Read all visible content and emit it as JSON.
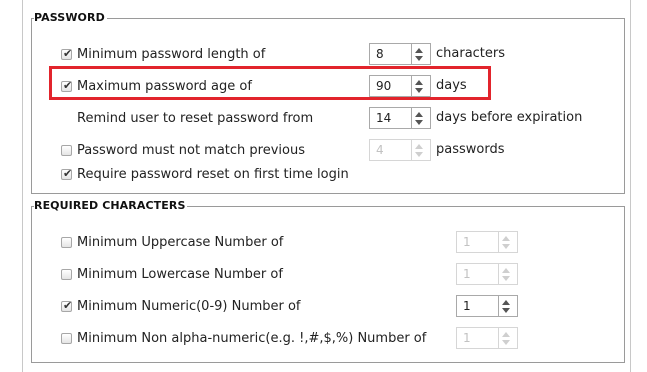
{
  "password": {
    "legend": "PASSWORD",
    "rows": [
      {
        "checked": true,
        "label": "Minimum password length of",
        "value": "8",
        "unit": "characters",
        "disabled": false
      },
      {
        "checked": true,
        "label": "Maximum password age of",
        "value": "90",
        "unit": "days",
        "disabled": false
      },
      {
        "checked": null,
        "label": "Remind user to reset password from",
        "value": "14",
        "unit": "days before expiration",
        "disabled": false
      },
      {
        "checked": false,
        "label": "Password must not match previous",
        "value": "4",
        "unit": "passwords",
        "disabled": true
      },
      {
        "checked": true,
        "label": "Require password reset on first time login"
      }
    ]
  },
  "required": {
    "legend": "REQUIRED CHARACTERS",
    "rows": [
      {
        "checked": false,
        "label": "Minimum Uppercase Number of",
        "value": "1",
        "disabled": true
      },
      {
        "checked": false,
        "label": "Minimum Lowercase Number of",
        "value": "1",
        "disabled": true
      },
      {
        "checked": true,
        "label": "Minimum Numeric(0-9) Number of",
        "value": "1",
        "disabled": false
      },
      {
        "checked": false,
        "label": "Minimum Non alpha-numeric(e.g. !,#,$,%) Number of",
        "value": "1",
        "disabled": true
      }
    ]
  },
  "highlight_color": "#e2242c",
  "icons": {
    "checkmark": "check-icon",
    "spin_up": "caret-up-icon",
    "spin_down": "caret-down-icon"
  }
}
